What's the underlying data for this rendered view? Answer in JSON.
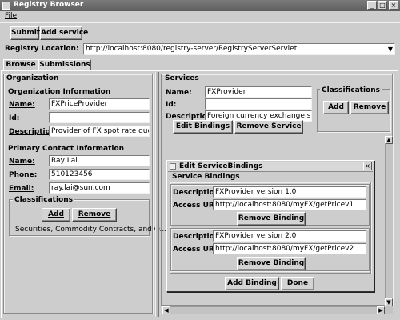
{
  "window": {
    "title": "Registry Browser",
    "controls": [
      "_",
      "□",
      "×"
    ]
  },
  "menu": {
    "file": "File"
  },
  "toolbar": {
    "submit": "Submit",
    "add_service": "Add service"
  },
  "registry": {
    "label": "Registry Location:",
    "value": "http://localhost:8080/registry-server/RegistryServerServlet"
  },
  "tabs": [
    {
      "label": "Browse"
    },
    {
      "label": "Submissions"
    }
  ],
  "organization": {
    "section_title": "Organization",
    "info_title": "Organization Information",
    "name_label": "Name:",
    "name_value": "FXPriceProvider",
    "id_label": "Id:",
    "id_value": "",
    "desc_label": "Description:",
    "desc_value": "Provider of FX spot rate quote",
    "contact_title": "Primary Contact Information",
    "contact_name_label": "Name:",
    "contact_name_value": "Ray Lai",
    "phone_label": "Phone:",
    "phone_value": "510123456",
    "email_label": "Email:",
    "email_value": "ray.lai@sun.com",
    "classifications_title": "Classifications",
    "add_label": "Add",
    "remove_label": "Remove",
    "classification_item": "Securities, Commodity Contracts, and O..."
  },
  "services": {
    "section_title": "Services",
    "name_label": "Name:",
    "name_value": "FXProvider",
    "id_label": "Id:",
    "id_value": "",
    "desc_label": "Description:",
    "desc_value": "Foreign currency exchange service",
    "edit_bindings": "Edit Bindings",
    "remove_service": "Remove Service",
    "classifications_title": "Classifications",
    "add_label": "Add",
    "remove_label": "Remove"
  },
  "dialog": {
    "title": "Edit ServiceBindings",
    "close": "×",
    "section_title": "Service Bindings",
    "bindings": [
      {
        "desc_label": "Description:",
        "desc_value": "FXProvider version 1.0",
        "uri_label": "Access URI:",
        "uri_value": "http://localhost:8080/myFX/getPricev1",
        "remove_label": "Remove Binding"
      },
      {
        "desc_label": "Description:",
        "desc_value": "FXProvider version 2.0",
        "uri_label": "Access URI:",
        "uri_value": "http://localhost:8080/myFX/getPricev2",
        "remove_label": "Remove Binding"
      }
    ],
    "add_binding": "Add Binding",
    "done": "Done"
  },
  "icons": {
    "dropdown": "chevron-down-icon",
    "scroll_up": "arrow-up-icon",
    "scroll_down": "arrow-down-icon",
    "scroll_left": "arrow-left-icon",
    "scroll_right": "arrow-right-icon"
  }
}
